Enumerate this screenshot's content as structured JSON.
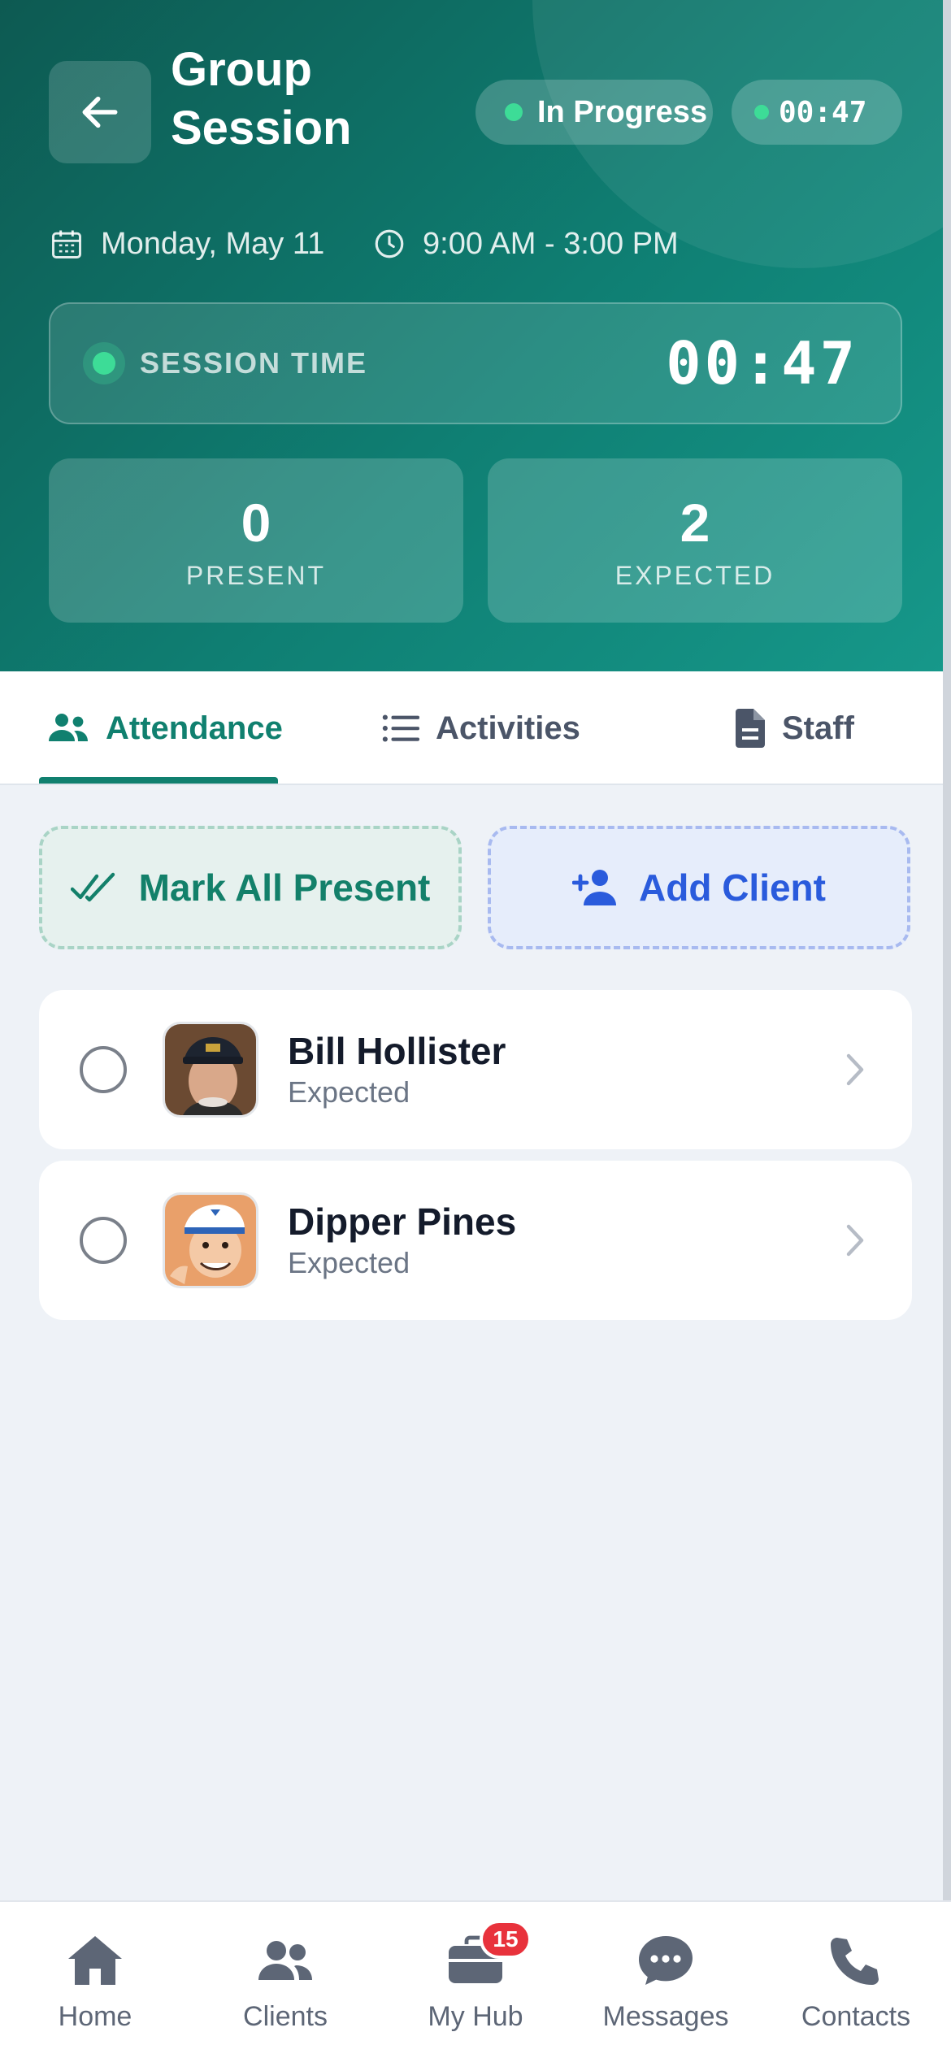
{
  "header": {
    "title": "Group Session",
    "status": "In Progress",
    "timer": "00:47",
    "date": "Monday, May 11",
    "time_range": "9:00 AM - 3:00 PM",
    "session_label": "SESSION TIME",
    "session_time": "00:47",
    "stats": {
      "present_value": "0",
      "present_label": "PRESENT",
      "expected_value": "2",
      "expected_label": "EXPECTED"
    }
  },
  "tabs": {
    "attendance": "Attendance",
    "activities": "Activities",
    "staff": "Staff",
    "active": "attendance"
  },
  "actions": {
    "mark_all": "Mark All Present",
    "add_client": "Add Client"
  },
  "clients": [
    {
      "name": "Bill Hollister",
      "status": "Expected",
      "avatar": "avatar-photo"
    },
    {
      "name": "Dipper Pines",
      "status": "Expected",
      "avatar": "avatar-cartoon"
    }
  ],
  "nav": {
    "home": "Home",
    "clients": "Clients",
    "hub": "My Hub",
    "hub_badge": "15",
    "messages": "Messages",
    "contacts": "Contacts"
  },
  "colors": {
    "header_primary": "#0f7f73",
    "accent_green": "#10806f",
    "accent_blue": "#2a5bdc",
    "status_dot": "#3ddc97",
    "badge": "#e8323c"
  }
}
